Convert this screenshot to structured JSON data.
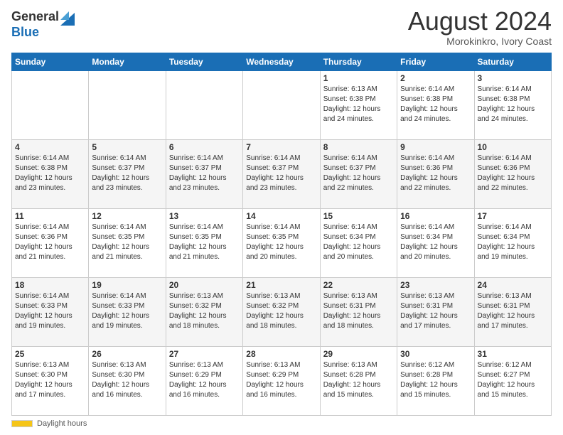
{
  "logo": {
    "general": "General",
    "blue": "Blue"
  },
  "header": {
    "title": "August 2024",
    "location": "Morokinkro, Ivory Coast"
  },
  "weekdays": [
    "Sunday",
    "Monday",
    "Tuesday",
    "Wednesday",
    "Thursday",
    "Friday",
    "Saturday"
  ],
  "footer": {
    "daylight_label": "Daylight hours"
  },
  "weeks": [
    [
      {
        "day": "",
        "info": ""
      },
      {
        "day": "",
        "info": ""
      },
      {
        "day": "",
        "info": ""
      },
      {
        "day": "",
        "info": ""
      },
      {
        "day": "1",
        "info": "Sunrise: 6:13 AM\nSunset: 6:38 PM\nDaylight: 12 hours\nand 24 minutes."
      },
      {
        "day": "2",
        "info": "Sunrise: 6:14 AM\nSunset: 6:38 PM\nDaylight: 12 hours\nand 24 minutes."
      },
      {
        "day": "3",
        "info": "Sunrise: 6:14 AM\nSunset: 6:38 PM\nDaylight: 12 hours\nand 24 minutes."
      }
    ],
    [
      {
        "day": "4",
        "info": "Sunrise: 6:14 AM\nSunset: 6:38 PM\nDaylight: 12 hours\nand 23 minutes."
      },
      {
        "day": "5",
        "info": "Sunrise: 6:14 AM\nSunset: 6:37 PM\nDaylight: 12 hours\nand 23 minutes."
      },
      {
        "day": "6",
        "info": "Sunrise: 6:14 AM\nSunset: 6:37 PM\nDaylight: 12 hours\nand 23 minutes."
      },
      {
        "day": "7",
        "info": "Sunrise: 6:14 AM\nSunset: 6:37 PM\nDaylight: 12 hours\nand 23 minutes."
      },
      {
        "day": "8",
        "info": "Sunrise: 6:14 AM\nSunset: 6:37 PM\nDaylight: 12 hours\nand 22 minutes."
      },
      {
        "day": "9",
        "info": "Sunrise: 6:14 AM\nSunset: 6:36 PM\nDaylight: 12 hours\nand 22 minutes."
      },
      {
        "day": "10",
        "info": "Sunrise: 6:14 AM\nSunset: 6:36 PM\nDaylight: 12 hours\nand 22 minutes."
      }
    ],
    [
      {
        "day": "11",
        "info": "Sunrise: 6:14 AM\nSunset: 6:36 PM\nDaylight: 12 hours\nand 21 minutes."
      },
      {
        "day": "12",
        "info": "Sunrise: 6:14 AM\nSunset: 6:35 PM\nDaylight: 12 hours\nand 21 minutes."
      },
      {
        "day": "13",
        "info": "Sunrise: 6:14 AM\nSunset: 6:35 PM\nDaylight: 12 hours\nand 21 minutes."
      },
      {
        "day": "14",
        "info": "Sunrise: 6:14 AM\nSunset: 6:35 PM\nDaylight: 12 hours\nand 20 minutes."
      },
      {
        "day": "15",
        "info": "Sunrise: 6:14 AM\nSunset: 6:34 PM\nDaylight: 12 hours\nand 20 minutes."
      },
      {
        "day": "16",
        "info": "Sunrise: 6:14 AM\nSunset: 6:34 PM\nDaylight: 12 hours\nand 20 minutes."
      },
      {
        "day": "17",
        "info": "Sunrise: 6:14 AM\nSunset: 6:34 PM\nDaylight: 12 hours\nand 19 minutes."
      }
    ],
    [
      {
        "day": "18",
        "info": "Sunrise: 6:14 AM\nSunset: 6:33 PM\nDaylight: 12 hours\nand 19 minutes."
      },
      {
        "day": "19",
        "info": "Sunrise: 6:14 AM\nSunset: 6:33 PM\nDaylight: 12 hours\nand 19 minutes."
      },
      {
        "day": "20",
        "info": "Sunrise: 6:13 AM\nSunset: 6:32 PM\nDaylight: 12 hours\nand 18 minutes."
      },
      {
        "day": "21",
        "info": "Sunrise: 6:13 AM\nSunset: 6:32 PM\nDaylight: 12 hours\nand 18 minutes."
      },
      {
        "day": "22",
        "info": "Sunrise: 6:13 AM\nSunset: 6:31 PM\nDaylight: 12 hours\nand 18 minutes."
      },
      {
        "day": "23",
        "info": "Sunrise: 6:13 AM\nSunset: 6:31 PM\nDaylight: 12 hours\nand 17 minutes."
      },
      {
        "day": "24",
        "info": "Sunrise: 6:13 AM\nSunset: 6:31 PM\nDaylight: 12 hours\nand 17 minutes."
      }
    ],
    [
      {
        "day": "25",
        "info": "Sunrise: 6:13 AM\nSunset: 6:30 PM\nDaylight: 12 hours\nand 17 minutes."
      },
      {
        "day": "26",
        "info": "Sunrise: 6:13 AM\nSunset: 6:30 PM\nDaylight: 12 hours\nand 16 minutes."
      },
      {
        "day": "27",
        "info": "Sunrise: 6:13 AM\nSunset: 6:29 PM\nDaylight: 12 hours\nand 16 minutes."
      },
      {
        "day": "28",
        "info": "Sunrise: 6:13 AM\nSunset: 6:29 PM\nDaylight: 12 hours\nand 16 minutes."
      },
      {
        "day": "29",
        "info": "Sunrise: 6:13 AM\nSunset: 6:28 PM\nDaylight: 12 hours\nand 15 minutes."
      },
      {
        "day": "30",
        "info": "Sunrise: 6:12 AM\nSunset: 6:28 PM\nDaylight: 12 hours\nand 15 minutes."
      },
      {
        "day": "31",
        "info": "Sunrise: 6:12 AM\nSunset: 6:27 PM\nDaylight: 12 hours\nand 15 minutes."
      }
    ]
  ]
}
